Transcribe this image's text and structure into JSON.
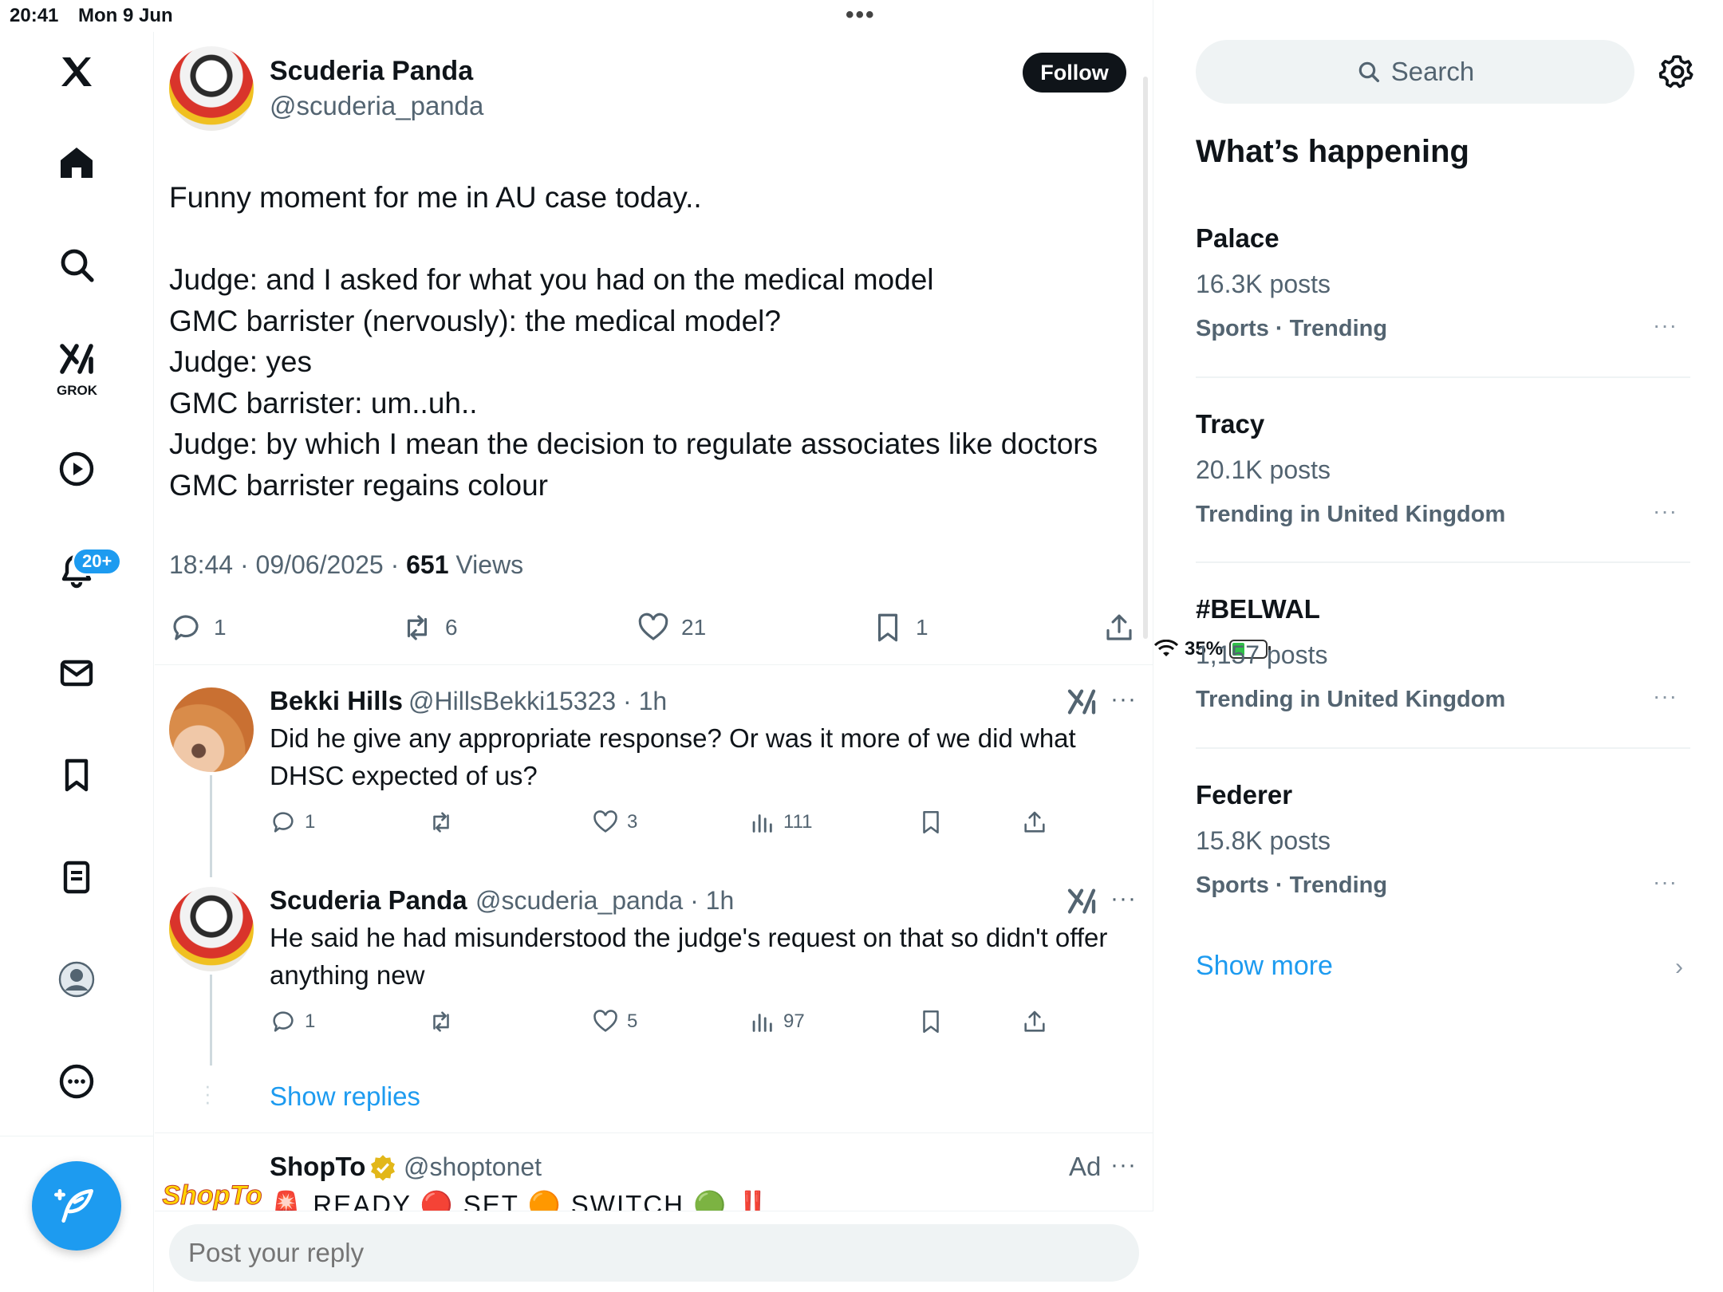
{
  "status_bar": {
    "time": "20:41",
    "date": "Mon 9 Jun",
    "battery": "35%",
    "battery_level": 0.35
  },
  "nav": {
    "items": [
      "x-logo",
      "home",
      "explore",
      "grok",
      "videos",
      "notifications",
      "messages",
      "bookmarks",
      "lists",
      "profile",
      "more"
    ],
    "grok_label": "GROK",
    "notifications_badge": "20+"
  },
  "tweet": {
    "author": "Scuderia Panda",
    "handle": "@scuderia_panda",
    "follow_label": "Follow",
    "text": "Funny moment for me in AU case today..\n\nJudge: and I asked for what you had on the medical model\nGMC barrister (nervously): the medical model?\nJudge: yes\nGMC barrister: um..uh..\nJudge: by which I mean the decision to regulate associates like doctors\nGMC barrister regains colour",
    "timestamp": "18:44 · 09/06/2025 · ",
    "views_count": "651",
    "views_label": " Views",
    "replies": "1",
    "reposts": "6",
    "likes": "21",
    "bookmarks": "1"
  },
  "replies": [
    {
      "name": "Bekki Hills",
      "handle": "@HillsBekki15323 · 1h",
      "text": "Did he give any appropriate response? Or was it more of we did what DHSC expected of us?",
      "replies": "1",
      "likes": "3",
      "views": "111"
    },
    {
      "name": "Scuderia Panda",
      "handle": "@scuderia_panda · 1h",
      "text": "He said he had misunderstood the judge's request on that so didn't offer anything new",
      "replies": "1",
      "likes": "5",
      "views": "97"
    }
  ],
  "show_replies": "Show replies",
  "ad": {
    "name": "ShopTo",
    "handle": "@shoptonet",
    "label": "Ad",
    "avatar_text": "ShopTo",
    "text": "🚨 READY 🔴 SET 🟠 SWITCH 🟢 ‼️"
  },
  "reply_placeholder": "Post your reply",
  "sidebar": {
    "search_placeholder": "Search",
    "title": "What’s happening",
    "trends": [
      {
        "name": "Palace",
        "count": "16.3K posts",
        "category": "Sports · Trending"
      },
      {
        "name": "Tracy",
        "count": "20.1K posts",
        "category": "Trending in United Kingdom"
      },
      {
        "name": "#BELWAL",
        "count": "1,157 posts",
        "category": "Trending in United Kingdom"
      },
      {
        "name": "Federer",
        "count": "15.8K posts",
        "category": "Sports · Trending"
      }
    ],
    "show_more": "Show more"
  },
  "colors": {
    "accent": "#1d9bf0",
    "text": "#0f1419",
    "muted": "#536471",
    "border": "#eff3f4"
  }
}
